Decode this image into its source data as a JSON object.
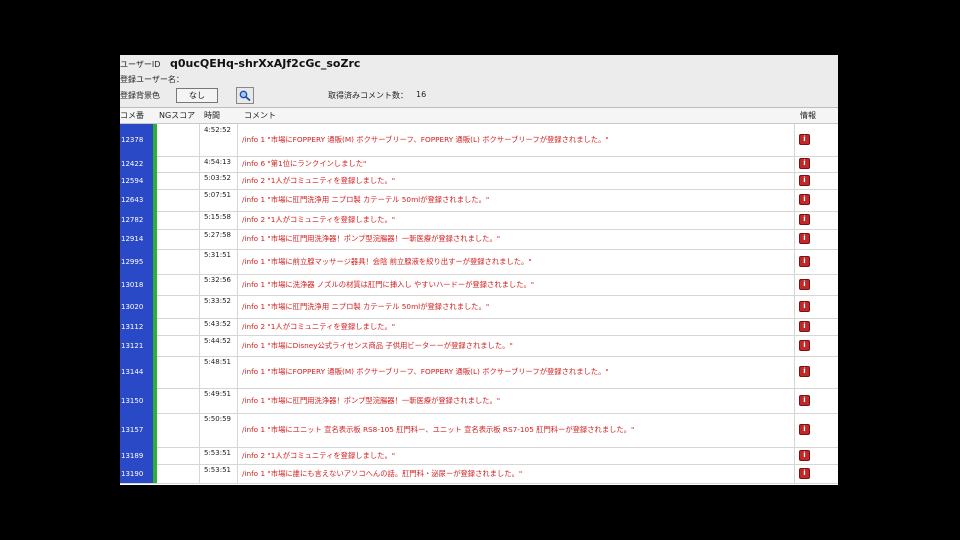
{
  "topbar": {
    "userid_label": "ユーザーID",
    "userid_value": "q0ucQEHq-shrXxAJf2cGc_soZrc",
    "username_label": "登録ユーザー名：",
    "color_label": "登録背景色",
    "color_button": "なし",
    "fetched_label": "取得済みコメント数：",
    "fetched_count": "16"
  },
  "columns": {
    "num": "コメ番",
    "ng": "NGスコア",
    "time": "時間",
    "comment": "コメント",
    "info": "情報"
  },
  "icons": {
    "search": "search-icon",
    "info": "info-icon"
  },
  "colors": {
    "num_bg": "#2a49c7",
    "green_strip": "#2fae3a",
    "comment_text": "#d42020",
    "info_bg": "#c0282a"
  },
  "rows": [
    {
      "num": "12378",
      "time": "4:52:52",
      "comment": "/info 1 \"市場にFOPPERY 通販(M) ボクサーブリーフ、FOPPERY 通販(L) ボクサーブリーフが登録されました。\""
    },
    {
      "num": "12422",
      "time": "4:54:13",
      "comment": "/info 6 \"第1位にランクインしました\""
    },
    {
      "num": "12594",
      "time": "5:03:52",
      "comment": "/info 2 \"1人がコミュニティを登録しました。\""
    },
    {
      "num": "12643",
      "time": "5:07:51",
      "comment": "/info 1 \"市場に肛門洗浄用 ニプロ製 カテーテル 50mlが登録されました。\""
    },
    {
      "num": "12782",
      "time": "5:15:58",
      "comment": "/info 2 \"1人がコミュニティを登録しました。\""
    },
    {
      "num": "12914",
      "time": "5:27:58",
      "comment": "/info 1 \"市場に肛門用洗浄器！ポンプ型浣腸器！一斬医療が登録されました。\""
    },
    {
      "num": "12995",
      "time": "5:31:51",
      "comment": "/info 1 \"市場に前立腺マッサージ器具！会陰 前立腺液を絞り出すーが登録されました。\""
    },
    {
      "num": "13018",
      "time": "5:32:56",
      "comment": "/info 1 \"市場に洗浄器 ノズルの材質は肛門に挿入し やすいハードーが登録されました。\""
    },
    {
      "num": "13020",
      "time": "5:33:52",
      "comment": "/info 1 \"市場に肛門洗浄用 ニプロ製 カテーテル 50mlが登録されました。\""
    },
    {
      "num": "13112",
      "time": "5:43:52",
      "comment": "/info 2 \"1人がコミュニティを登録しました。\""
    },
    {
      "num": "13121",
      "time": "5:44:52",
      "comment": "/info 1 \"市場にDisney公式ライセンス商品 子供用ビーターーが登録されました。\""
    },
    {
      "num": "13144",
      "time": "5:48:51",
      "comment": "/info 1 \"市場にFOPPERY 通販(M) ボクサーブリーフ、FOPPERY 通販(L) ボクサーブリーフが登録されました。\""
    },
    {
      "num": "13150",
      "time": "5:49:51",
      "comment": "/info 1 \"市場に肛門用洗浄器！ポンプ型浣腸器！一斬医療が登録されました。\""
    },
    {
      "num": "13157",
      "time": "5:50:59",
      "comment": "/info 1 \"市場にユニット 宣名表示板 RS8-105 肛門科ー、ユニット 宣名表示板 RS7-105 肛門科ーが登録されました。\""
    },
    {
      "num": "13189",
      "time": "5:53:51",
      "comment": "/info 2 \"1人がコミュニティを登録しました。\""
    },
    {
      "num": "13190",
      "time": "5:53:51",
      "comment": "/info 1 \"市場に誰にも言えないアソコへんの話。肛門科・泌尿ーが登録されました。\""
    }
  ]
}
